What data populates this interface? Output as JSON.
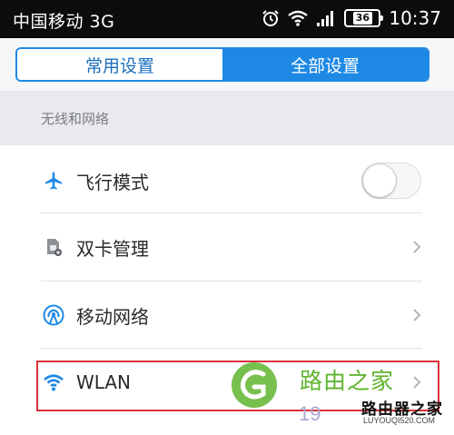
{
  "status_bar": {
    "carrier": "中国移动 3G",
    "battery_level": "36",
    "time": "10:37",
    "icons": [
      "alarm-icon",
      "wifi-icon",
      "signal-icon",
      "battery-icon"
    ]
  },
  "tabs": [
    {
      "label": "常用设置",
      "active": false
    },
    {
      "label": "全部设置",
      "active": true
    }
  ],
  "section": {
    "title": "无线和网络"
  },
  "items": [
    {
      "label": "飞行模式",
      "icon": "airplane-icon",
      "control": "toggle",
      "toggle_on": false
    },
    {
      "label": "双卡管理",
      "icon": "sim-card-icon",
      "control": "chevron"
    },
    {
      "label": "移动网络",
      "icon": "mobile-network-icon",
      "control": "chevron"
    },
    {
      "label": "WLAN",
      "icon": "wifi-icon",
      "control": "chevron",
      "highlighted": true
    }
  ],
  "watermark": {
    "text": "路由之家",
    "number": "19",
    "brand_cn": "路由器之家",
    "brand_url": "LUYOUQI520.COM"
  },
  "colors": {
    "accent": "#1e88e5",
    "highlight": "#d9323a",
    "watermark_green": "#5fb52f"
  }
}
